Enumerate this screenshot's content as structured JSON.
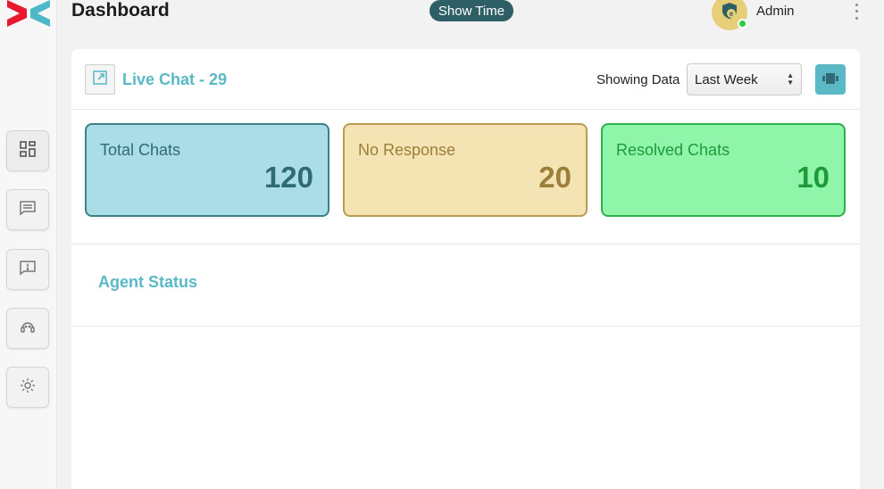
{
  "header": {
    "title": "Dashboard",
    "show_time_label": "Show Time",
    "user_name": "Admin"
  },
  "sidebar": {
    "items": [
      {
        "icon": "dashboard-icon",
        "active": true
      },
      {
        "icon": "chat-icon",
        "active": false
      },
      {
        "icon": "alert-message-icon",
        "active": false
      },
      {
        "icon": "support-agent-icon",
        "active": false
      },
      {
        "icon": "gear-icon",
        "active": false
      }
    ]
  },
  "card": {
    "title": "Live Chat - 29",
    "showing_label": "Showing Data",
    "range_selected": "Last Week"
  },
  "stats": [
    {
      "label": "Total Chats",
      "value": "120"
    },
    {
      "label": "No Response",
      "value": "20"
    },
    {
      "label": "Resolved Chats",
      "value": "10"
    }
  ],
  "agent_status": {
    "title": "Agent Status"
  },
  "colors": {
    "accent": "#5bb9c6",
    "show_time_bg": "#2f5f66",
    "logo_red": "#e8192c",
    "logo_teal": "#4fb8c8"
  }
}
